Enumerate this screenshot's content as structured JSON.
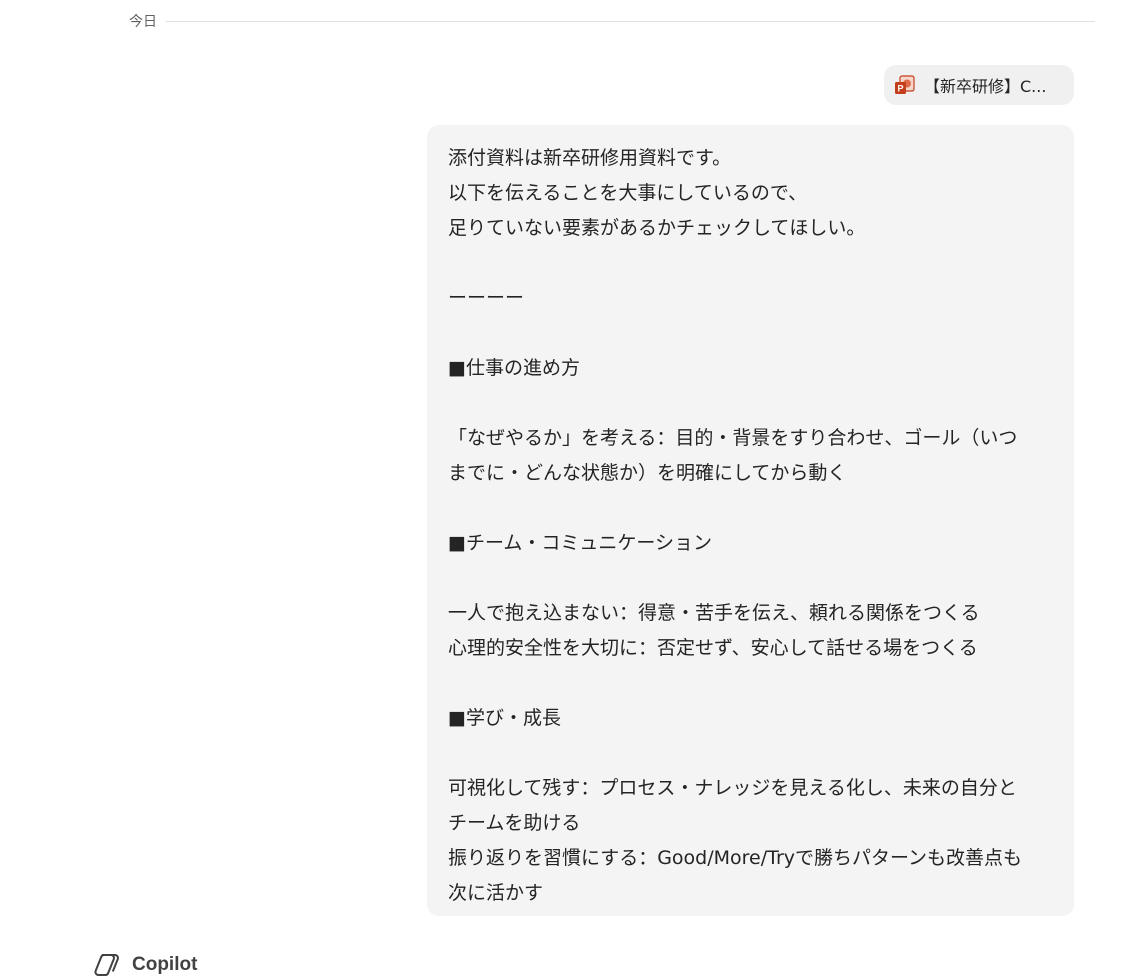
{
  "date_divider": {
    "label": "今日"
  },
  "attachment": {
    "name": "【新卒研修】C...",
    "icon": "powerpoint-file-icon",
    "icon_colors": {
      "red": "#c43e1c",
      "light": "#f7d7cc"
    }
  },
  "message": {
    "lines": [
      "添付資料は新卒研修用資料です。",
      "以下を伝えることを大事にしているので、",
      "足りていない要素があるかチェックしてほしい。",
      "",
      "ーーーー",
      "",
      "■仕事の進め方",
      "",
      "「なぜやるか」を考える：目的・背景をすり合わせ、ゴール（いつ",
      "までに・どんな状態か）を明確にしてから動く",
      "",
      "■チーム・コミュニケーション",
      "",
      "一人で抱え込まない：得意・苦手を伝え、頼れる関係をつくる",
      "心理的安全性を大切に：否定せず、安心して話せる場をつくる",
      "",
      "■学び・成長",
      "",
      "可視化して残す：プロセス・ナレッジを見える化し、未来の自分と",
      "チームを助ける",
      "振り返りを習慣にする：Good/More/Tryで勝ちパターンも改善点も",
      "次に活かす"
    ]
  },
  "assistant": {
    "name": "Copilot",
    "icon": "copilot-icon"
  },
  "colors": {
    "bubble_bg": "#f4f4f4",
    "chip_bg": "#f0f0f0",
    "text": "#242424",
    "muted": "#616161"
  }
}
